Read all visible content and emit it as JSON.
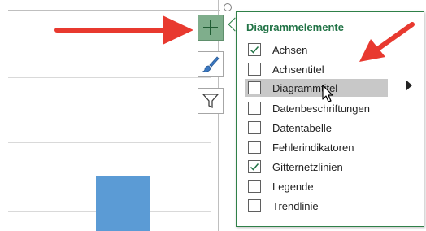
{
  "panel": {
    "title": "Diagrammelemente",
    "items": [
      {
        "label": "Achsen",
        "checked": true
      },
      {
        "label": "Achsentitel",
        "checked": false
      },
      {
        "label": "Diagrammtitel",
        "checked": false,
        "hovered": true,
        "has_submenu": true
      },
      {
        "label": "Datenbeschriftungen",
        "checked": false
      },
      {
        "label": "Datentabelle",
        "checked": false
      },
      {
        "label": "Fehlerindikatoren",
        "checked": false
      },
      {
        "label": "Gitternetzlinien",
        "checked": true
      },
      {
        "label": "Legende",
        "checked": false
      },
      {
        "label": "Trendlinie",
        "checked": false
      }
    ]
  },
  "side_buttons": [
    {
      "icon": "plus-icon",
      "active": true
    },
    {
      "icon": "paintbrush-icon",
      "active": false
    },
    {
      "icon": "filter-icon",
      "active": false
    }
  ],
  "colors": {
    "accent_green": "#217346",
    "arrow_red": "#e8392f",
    "bar_blue": "#5b9bd5",
    "active_button": "#7fae8c"
  }
}
